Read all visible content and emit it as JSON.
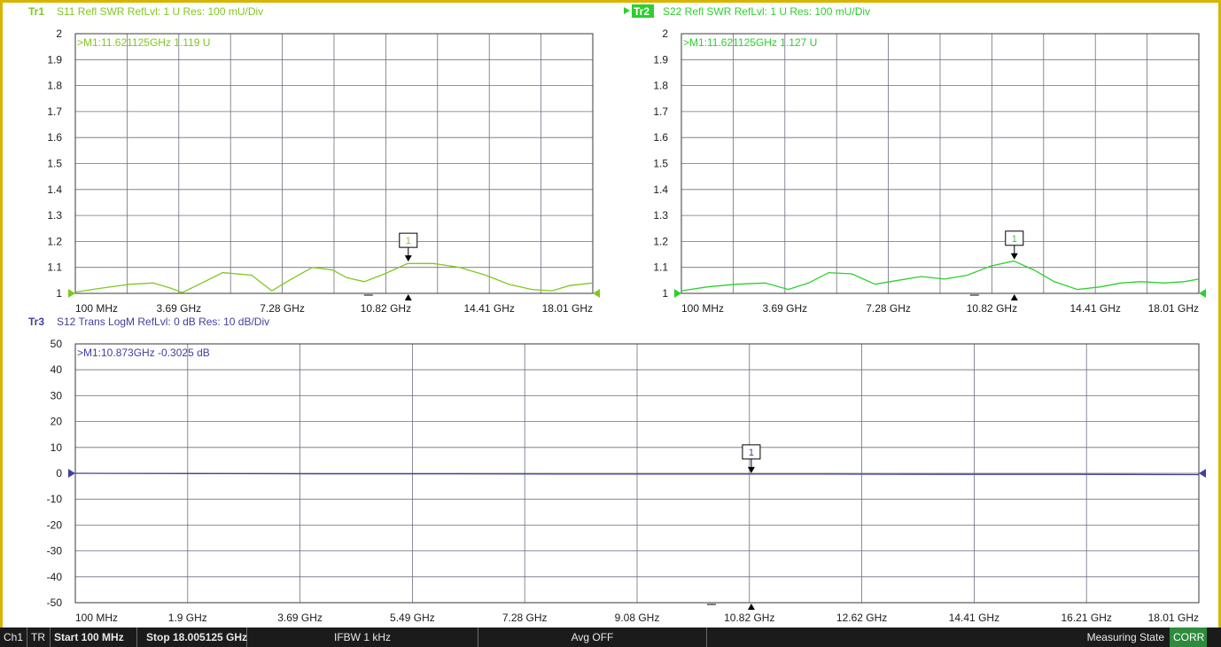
{
  "colors": {
    "tr1": "#7fc820",
    "tr2": "#2dcf2d",
    "tr3": "#4040a0",
    "tr2_tag_bg": "#2dcf2d",
    "grid": "#6f6f80",
    "axis_text": "#1a1a1a",
    "frame": "#d8b400",
    "status_bg": "#1b1b1b",
    "corr_bg": "#2e8b3d"
  },
  "chart_data": [
    {
      "type": "line",
      "trace": "Tr1",
      "title": "S11 Refl SWR RefLvl: 1  U Res: 100 mU/Div",
      "marker_readout": ">M1:11.621125GHz  1.119  U",
      "marker": {
        "id": "1",
        "x_ghz": 11.621125,
        "y": 1.119
      },
      "ylim": [
        1,
        2
      ],
      "yticks": [
        "2",
        "1.9",
        "1.8",
        "1.7",
        "1.6",
        "1.5",
        "1.4",
        "1.3",
        "1.2",
        "1.1",
        "1"
      ],
      "xlim_ghz": [
        0.1,
        18.005125
      ],
      "xticks": [
        "100 MHz",
        "3.69 GHz",
        "7.28 GHz",
        "10.82 GHz",
        "14.41 GHz",
        "18.01 GHz"
      ],
      "grid": true,
      "series": [
        {
          "x": [
            0.1,
            1,
            2,
            2.8,
            3.4,
            3.8,
            4.3,
            5.2,
            6.2,
            6.9,
            7.5,
            8.3,
            9,
            9.5,
            10.1,
            10.8,
            11.6,
            12.5,
            13.4,
            14.3,
            15.1,
            15.9,
            16.6,
            17.2,
            18.0
          ],
          "y": [
            1.005,
            1.02,
            1.035,
            1.04,
            1.02,
            1.003,
            1.03,
            1.08,
            1.07,
            1.01,
            1.05,
            1.1,
            1.09,
            1.06,
            1.045,
            1.075,
            1.115,
            1.115,
            1.1,
            1.07,
            1.035,
            1.015,
            1.01,
            1.03,
            1.04
          ]
        }
      ]
    },
    {
      "type": "line",
      "trace": "Tr2",
      "title": "S22 Refl SWR RefLvl: 1  U Res: 100 mU/Div",
      "marker_readout": ">M1:11.621125GHz  1.127  U",
      "marker": {
        "id": "1",
        "x_ghz": 11.621125,
        "y": 1.127
      },
      "ylim": [
        1,
        2
      ],
      "yticks": [
        "2",
        "1.9",
        "1.8",
        "1.7",
        "1.6",
        "1.5",
        "1.4",
        "1.3",
        "1.2",
        "1.1",
        "1"
      ],
      "xlim_ghz": [
        0.1,
        18.005125
      ],
      "xticks": [
        "100 MHz",
        "3.69 GHz",
        "7.28 GHz",
        "10.82 GHz",
        "14.41 GHz",
        "18.01 GHz"
      ],
      "grid": true,
      "series": [
        {
          "x": [
            0.1,
            1,
            2,
            3,
            3.8,
            4.5,
            5.2,
            6,
            6.8,
            7.6,
            8.4,
            9.2,
            10,
            10.8,
            11.6,
            12.3,
            13,
            13.8,
            14.6,
            15.3,
            16,
            16.8,
            17.5,
            18.0
          ],
          "y": [
            1.01,
            1.025,
            1.035,
            1.04,
            1.015,
            1.04,
            1.08,
            1.075,
            1.035,
            1.05,
            1.065,
            1.055,
            1.07,
            1.105,
            1.125,
            1.09,
            1.045,
            1.015,
            1.025,
            1.04,
            1.045,
            1.04,
            1.045,
            1.055
          ]
        }
      ]
    },
    {
      "type": "line",
      "trace": "Tr3",
      "title": "S12 Trans LogM RefLvl: 0  dB Res: 10  dB/Div",
      "marker_readout": ">M1:10.873GHz  -0.3025  dB",
      "marker": {
        "id": "1",
        "x_ghz": 10.873,
        "y": -0.3025
      },
      "ylim": [
        -50,
        50
      ],
      "yticks": [
        "50",
        "40",
        "30",
        "20",
        "10",
        "0",
        "-10",
        "-20",
        "-30",
        "-40",
        "-50"
      ],
      "xlim_ghz": [
        0.1,
        18.005125
      ],
      "xticks": [
        "100 MHz",
        "1.9 GHz",
        "3.69 GHz",
        "5.49 GHz",
        "7.28 GHz",
        "9.08 GHz",
        "10.82 GHz",
        "12.62 GHz",
        "14.41 GHz",
        "16.21 GHz",
        "18.01 GHz"
      ],
      "grid": true,
      "series": [
        {
          "x": [
            0.1,
            2,
            4,
            6,
            8,
            10,
            10.873,
            12,
            14,
            16,
            18.0
          ],
          "y": [
            0,
            -0.1,
            -0.2,
            -0.2,
            -0.3,
            -0.3,
            -0.3025,
            -0.3,
            -0.4,
            -0.4,
            -0.5
          ]
        }
      ]
    }
  ],
  "traces": {
    "tr1": {
      "tag": "Tr1",
      "header": "S11 Refl SWR RefLvl: 1  U Res: 100 mU/Div"
    },
    "tr2": {
      "tag": "Tr2",
      "header": "S22 Refl SWR RefLvl: 1  U Res: 100 mU/Div"
    },
    "tr3": {
      "tag": "Tr3",
      "header": "S12 Trans LogM RefLvl: 0  dB Res: 10  dB/Div"
    }
  },
  "statusbar": {
    "channel": "Ch1",
    "mode": "TR",
    "start": "Start 100 MHz",
    "stop": "Stop 18.005125 GHz",
    "ifbw": "IFBW 1 kHz",
    "avg": "Avg OFF",
    "state": "Measuring State",
    "corr": "CORR"
  }
}
